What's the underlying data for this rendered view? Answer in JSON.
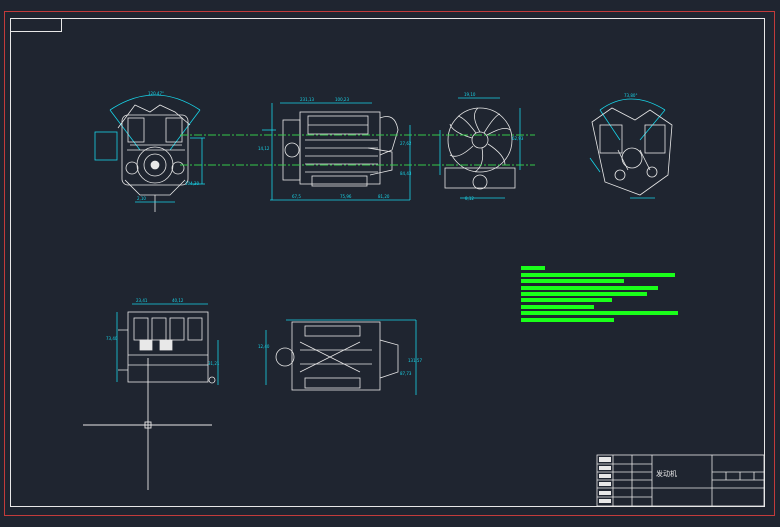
{
  "drawing": {
    "title_block": {
      "part_name": "发动机"
    },
    "colors": {
      "background": "#1f2530",
      "frame_red": "#c23b3b",
      "line_white": "#e8e8e8",
      "dimension_cyan": "#18d4e8",
      "centerline_green": "#35c94a",
      "notes_green": "#1aff1a"
    },
    "icons": {
      "crosshair": "ucs-crosshair-icon"
    }
  }
}
